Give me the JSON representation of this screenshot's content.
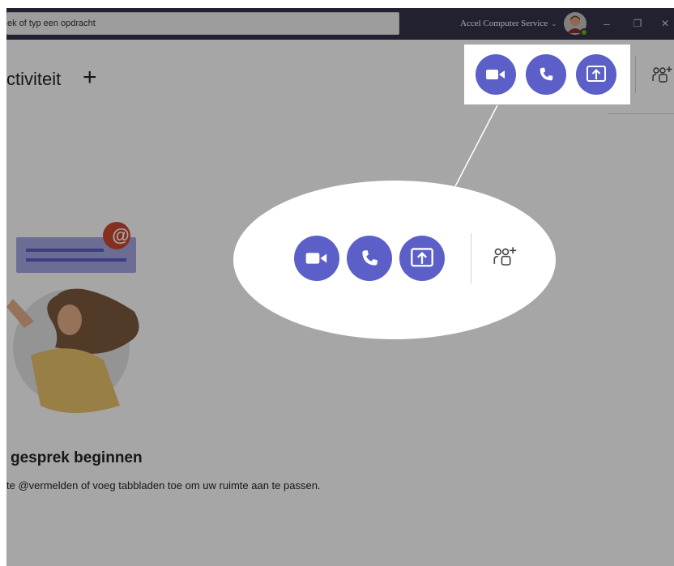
{
  "titlebar": {
    "search_text": "ek of typ een opdracht",
    "account_name": "Accel Computer Service",
    "account_chevron": "⌄",
    "minimize_label": "–",
    "restore_label": "❐",
    "close_label": "✕"
  },
  "channel": {
    "tab_title": "ctiviteit",
    "add_tab_label": "+"
  },
  "header_actions": [
    {
      "name": "video-call",
      "icon": "video-camera-icon"
    },
    {
      "name": "audio-call",
      "icon": "phone-icon"
    },
    {
      "name": "share-screen",
      "icon": "share-screen-icon"
    },
    {
      "name": "add-people",
      "icon": "add-people-icon"
    }
  ],
  "empty_state": {
    "headline": "gesprek beginnen",
    "description": "te @vermelden of voeg tabbladen toe om uw ruimte aan te passen.",
    "mention_symbol": "@"
  },
  "colors": {
    "titlebar": "#33344a",
    "accent": "#5b5fc7",
    "mention_badge": "#cc4a31",
    "presence_available": "#6bb700"
  }
}
